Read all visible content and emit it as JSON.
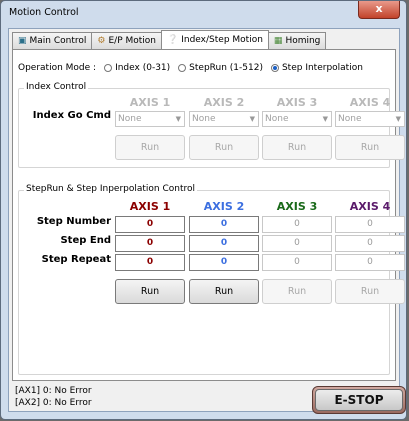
{
  "window": {
    "title": "Motion Control",
    "close_label": "x"
  },
  "tabs": [
    {
      "label": "Main Control",
      "icon": "monitor-icon"
    },
    {
      "label": "E/P Motion",
      "icon": "gears-icon"
    },
    {
      "label": "Index/Step Motion",
      "icon": "lightbulb-icon"
    },
    {
      "label": "Homing",
      "icon": "homing-icon"
    }
  ],
  "operation_mode": {
    "label": "Operation Mode :",
    "options": [
      {
        "label": "Index (0-31)",
        "selected": false
      },
      {
        "label": "StepRun (1-512)",
        "selected": false
      },
      {
        "label": "Step Interpolation",
        "selected": true
      }
    ]
  },
  "index_control": {
    "title": "Index Control",
    "axes": [
      "AXIS 1",
      "AXIS 2",
      "AXIS 3",
      "AXIS 4"
    ],
    "row_label": "Index Go Cmd",
    "combos": [
      "None",
      "None",
      "None",
      "None"
    ],
    "run_label": "Run"
  },
  "step_control": {
    "title": "StepRun & Step Inperpolation Control",
    "axes": [
      "AXIS 1",
      "AXIS 2",
      "AXIS 3",
      "AXIS 4"
    ],
    "axis_colors": [
      "#8b0000",
      "#3c6fe0",
      "#1a6a1a",
      "#5a1a6a"
    ],
    "rows": [
      {
        "label": "Step Number",
        "values": [
          "0",
          "0",
          "0",
          "0"
        ]
      },
      {
        "label": "Step End",
        "values": [
          "0",
          "0",
          "0",
          "0"
        ]
      },
      {
        "label": "Step Repeat",
        "values": [
          "0",
          "0",
          "0",
          "0"
        ]
      }
    ],
    "run_label": "Run"
  },
  "status": {
    "lines": [
      "[AX1] 0: No Error",
      "[AX2] 0: No Error"
    ]
  },
  "estop_label": "E-STOP"
}
